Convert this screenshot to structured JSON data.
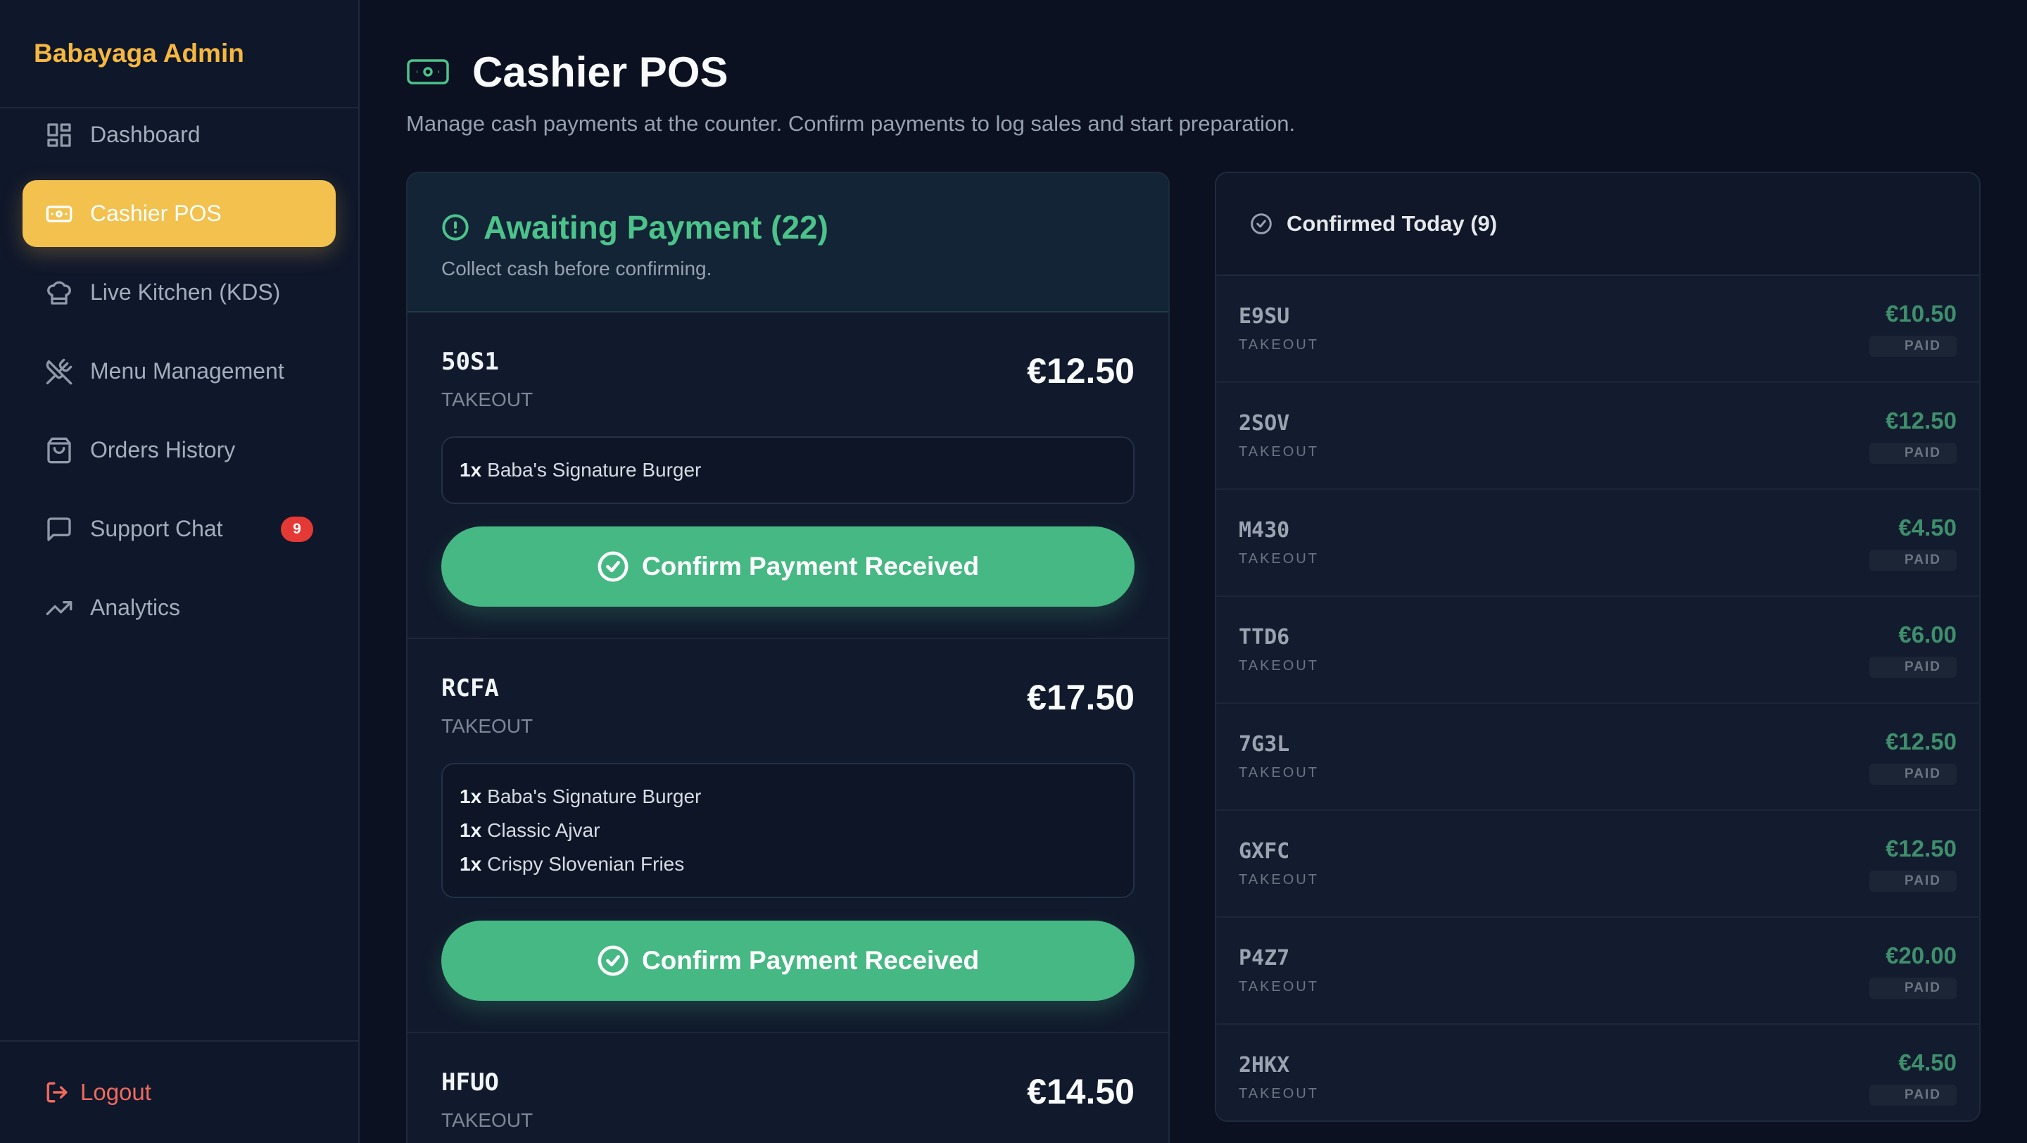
{
  "sidebar": {
    "brand": "Babayaga Admin",
    "items": [
      {
        "label": "Dashboard"
      },
      {
        "label": "Cashier POS"
      },
      {
        "label": "Live Kitchen (KDS)"
      },
      {
        "label": "Menu Management"
      },
      {
        "label": "Orders History"
      },
      {
        "label": "Support Chat",
        "badge": "9"
      },
      {
        "label": "Analytics"
      }
    ],
    "logout": "Logout"
  },
  "header": {
    "title": "Cashier POS",
    "subtitle": "Manage cash payments at the counter. Confirm payments to log sales and start preparation."
  },
  "awaiting": {
    "title": "Awaiting Payment (22)",
    "subtitle": "Collect cash before confirming.",
    "confirm_label": "Confirm Payment Received",
    "orders": [
      {
        "code": "50S1",
        "type": "TAKEOUT",
        "price": "€12.50",
        "items": [
          {
            "qty": "1x",
            "name": "Baba's Signature Burger"
          }
        ]
      },
      {
        "code": "RCFA",
        "type": "TAKEOUT",
        "price": "€17.50",
        "items": [
          {
            "qty": "1x",
            "name": "Baba's Signature Burger"
          },
          {
            "qty": "1x",
            "name": "Classic Ajvar"
          },
          {
            "qty": "1x",
            "name": "Crispy Slovenian Fries"
          }
        ]
      },
      {
        "code": "HFUO",
        "type": "TAKEOUT",
        "price": "€14.50",
        "items": []
      }
    ]
  },
  "confirmed": {
    "title": "Confirmed Today (9)",
    "paid_label": "PAID",
    "orders": [
      {
        "code": "E9SU",
        "type": "TAKEOUT",
        "price": "€10.50"
      },
      {
        "code": "2SOV",
        "type": "TAKEOUT",
        "price": "€12.50"
      },
      {
        "code": "M430",
        "type": "TAKEOUT",
        "price": "€4.50"
      },
      {
        "code": "TTD6",
        "type": "TAKEOUT",
        "price": "€6.00"
      },
      {
        "code": "7G3L",
        "type": "TAKEOUT",
        "price": "€12.50"
      },
      {
        "code": "GXFC",
        "type": "TAKEOUT",
        "price": "€12.50"
      },
      {
        "code": "P4Z7",
        "type": "TAKEOUT",
        "price": "€20.00"
      },
      {
        "code": "2HKX",
        "type": "TAKEOUT",
        "price": "€4.50"
      }
    ]
  },
  "colors": {
    "accent": "#f2c14e",
    "success": "#45b883",
    "danger": "#e53935",
    "background": "#0b1120"
  }
}
